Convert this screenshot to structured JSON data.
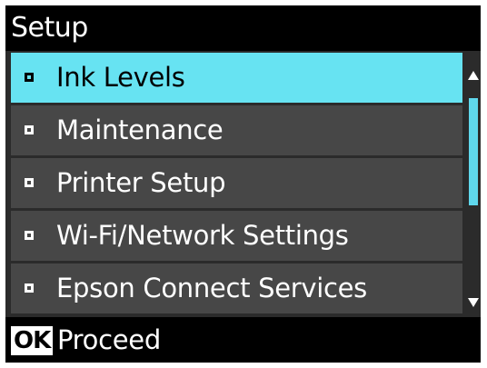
{
  "title": "Setup",
  "menu": {
    "items": [
      {
        "label": "Ink Levels",
        "selected": true
      },
      {
        "label": "Maintenance",
        "selected": false
      },
      {
        "label": "Printer Setup",
        "selected": false
      },
      {
        "label": "Wi-Fi/Network Settings",
        "selected": false
      },
      {
        "label": "Epson Connect Services",
        "selected": false
      }
    ]
  },
  "footer": {
    "button_label": "OK",
    "action_label": "Proceed"
  },
  "colors": {
    "selection": "#67e3f2",
    "item_background": "#474747",
    "bar_background": "#000000"
  }
}
